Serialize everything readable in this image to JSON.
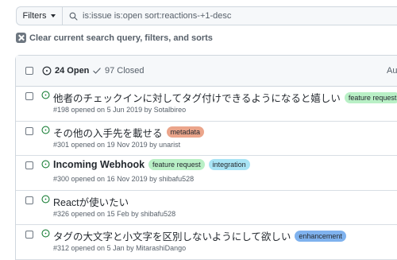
{
  "search": {
    "filters_label": "Filters",
    "query": "is:issue is:open sort:reactions-+1-desc"
  },
  "clear": {
    "label": "Clear current search query, filters, and sorts"
  },
  "header": {
    "open_count": "24 Open",
    "closed_count": "97 Closed",
    "author_label": "Aut"
  },
  "issues": [
    {
      "title": "他者のチェックインに対してタグ付けできるようになると嬉しい",
      "meta": "#198 opened on 5 Jun 2019 by Sotalbireo",
      "labels": [
        {
          "text": "feature request",
          "color": "#b9f0c6"
        }
      ]
    },
    {
      "title": "その他の入手先を載せる",
      "meta": "#301 opened on 19 Nov 2019 by unarist",
      "labels": [
        {
          "text": "metadata",
          "color": "#eba58b"
        }
      ]
    },
    {
      "title": "Incoming Webhook",
      "meta": "#300 opened on 16 Nov 2019 by shibafu528",
      "labels": [
        {
          "text": "feature request",
          "color": "#b9f0c6"
        },
        {
          "text": "integration",
          "color": "#a8e4f5"
        }
      ]
    },
    {
      "title": "Reactが使いたい",
      "meta": "#326 opened on 15 Feb by shibafu528",
      "labels": []
    },
    {
      "title": "タグの大文字と小文字を区別しないようにして欲しい",
      "meta": "#312 opened on 5 Jan by MitarashiDango",
      "labels": [
        {
          "text": "enhancement",
          "color": "#7fb2ee"
        }
      ]
    }
  ],
  "colors": {
    "open_icon": "#1a7f37",
    "border": "#d0d7de",
    "header_bg": "#f6f8fa"
  }
}
